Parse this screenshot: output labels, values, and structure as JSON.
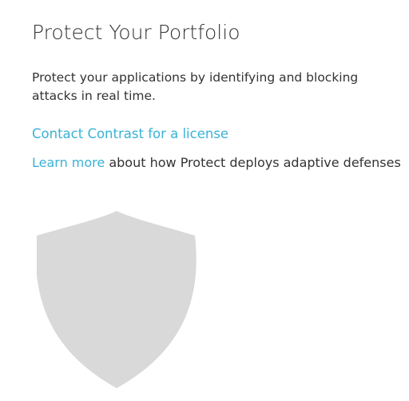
{
  "header": {
    "title": "Protect Your Portfolio"
  },
  "main": {
    "description": "Protect your applications by identifying and blocking attacks in real time.",
    "contact_link": "Contact Contrast for a license",
    "learn_more_link": "Learn more",
    "learn_more_suffix": " about how Protect deploys adaptive defenses"
  },
  "illustration": {
    "icon": "shield-icon",
    "color": "#d9d9d9"
  },
  "colors": {
    "link": "#3ab2d6",
    "text": "#333333"
  }
}
